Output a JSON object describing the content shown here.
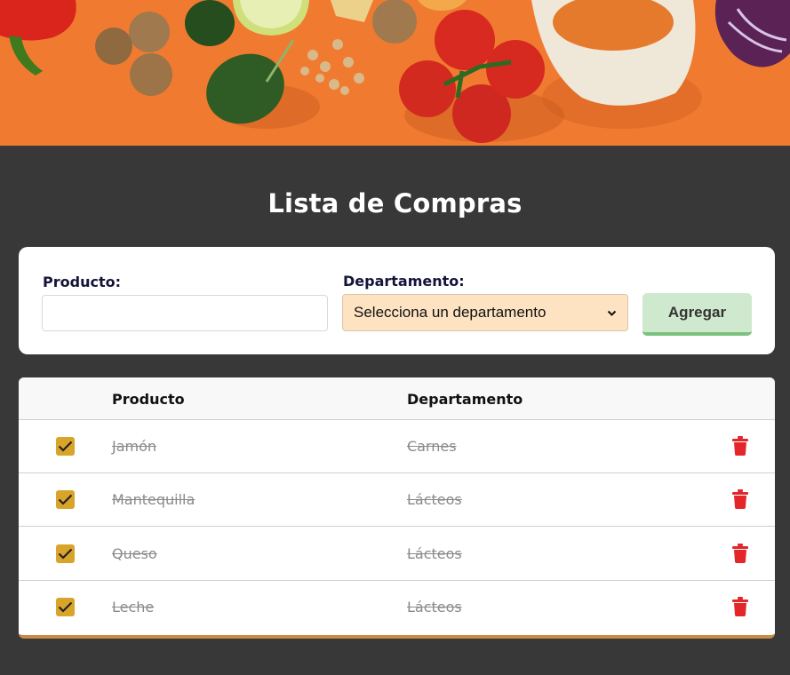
{
  "app": {
    "title": "Lista de Compras"
  },
  "form": {
    "product_label": "Producto:",
    "product_value": "",
    "department_label": "Departamento:",
    "department_selected": "Selecciona un departamento",
    "add_label": "Agregar"
  },
  "table": {
    "headers": {
      "product": "Producto",
      "department": "Departamento"
    },
    "rows": [
      {
        "product": "Jamón",
        "department": "Carnes",
        "checked": true
      },
      {
        "product": "Mantequilla",
        "department": "Lácteos",
        "checked": true
      },
      {
        "product": "Queso",
        "department": "Lácteos",
        "checked": true
      },
      {
        "product": "Leche",
        "department": "Lácteos",
        "checked": true
      }
    ]
  },
  "icons": {
    "check": "check-icon",
    "delete": "trash-icon",
    "select_arrow": "chevron-down-icon"
  },
  "colors": {
    "background": "#383838",
    "banner": "#f0782e",
    "select_bg": "#fde3c2",
    "add_button": "#cfe9cf",
    "checkbox": "#d9a42a",
    "trash": "#e3262a"
  }
}
